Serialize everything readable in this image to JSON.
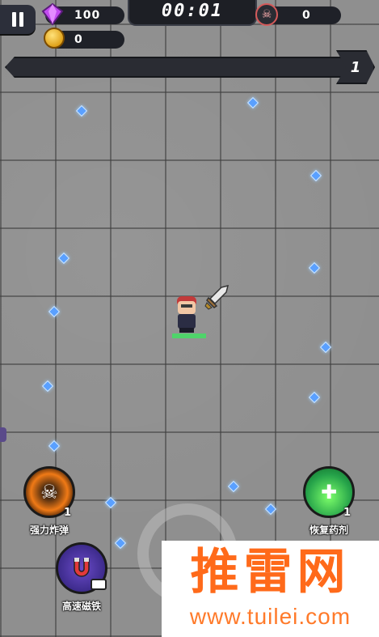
{
  "hud": {
    "gems": "100",
    "timer": "00:01",
    "kills": "0",
    "coins": "0",
    "level": "1",
    "xp_progress": 0.0
  },
  "player": {
    "hp_fraction": 1.0
  },
  "skills": {
    "bomb": {
      "label": "强力炸弹",
      "count": "1",
      "icon": "bomb-skull-icon"
    },
    "potion": {
      "label": "恢复药剂",
      "count": "1",
      "icon": "potion-icon"
    },
    "magnet": {
      "label": "高速磁铁",
      "icon": "magnet-icon"
    }
  },
  "watermark": {
    "title": "推雷网",
    "url": "www.tuilei.com"
  },
  "colors": {
    "accent": "#ff6a1a",
    "hud_dark": "#1f2128",
    "xp": "#6be06b",
    "gem": "#5aa0ff"
  }
}
